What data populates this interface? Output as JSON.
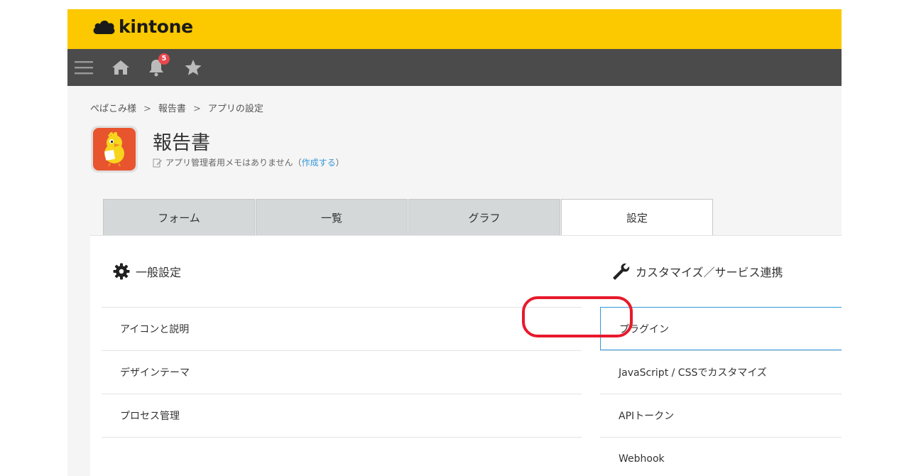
{
  "header": {
    "logo_text": "kintone"
  },
  "nav": {
    "notification_count": "5"
  },
  "breadcrumb": [
    "ぺぱこみ様",
    "報告書",
    "アプリの設定"
  ],
  "breadcrumb_sep": ">",
  "app": {
    "title": "報告書",
    "memo_text": "アプリ管理者用メモはありません（",
    "memo_link": "作成する",
    "memo_close": "）"
  },
  "tabs": [
    "フォーム",
    "一覧",
    "グラフ",
    "設定"
  ],
  "general": {
    "title": "一般設定",
    "items": [
      "アイコンと説明",
      "デザインテーマ",
      "プロセス管理"
    ]
  },
  "custom": {
    "title": "カスタマイズ／サービス連携",
    "items": [
      "プラグイン",
      "JavaScript / CSSでカスタマイズ",
      "APIトークン",
      "Webhook"
    ]
  },
  "colors": {
    "header": "#fcc800",
    "nav": "#4b4b4b",
    "accent": "#3498db",
    "highlight": "#e8192c"
  }
}
